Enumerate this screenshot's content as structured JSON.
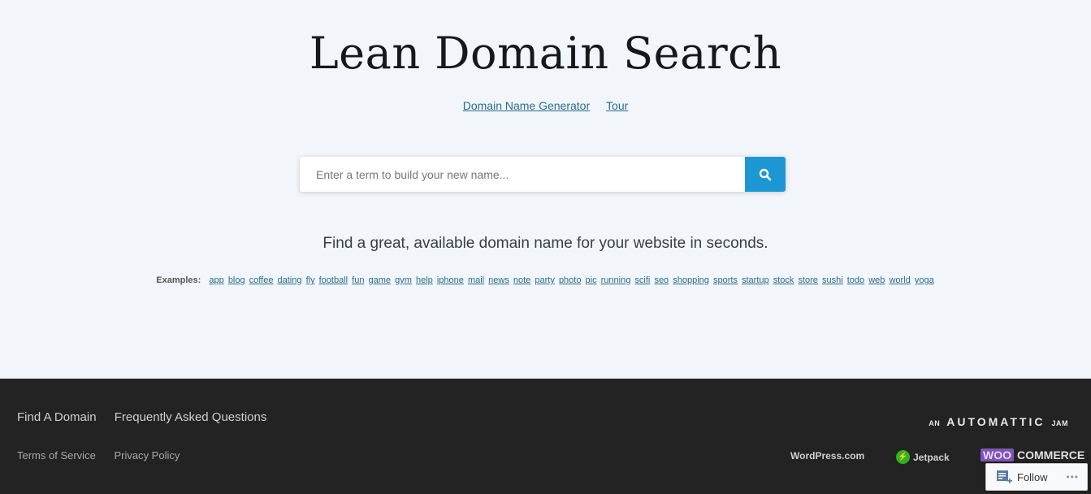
{
  "header": {
    "title": "Lean Domain Search",
    "nav": [
      {
        "label": "Domain Name Generator"
      },
      {
        "label": "Tour"
      }
    ]
  },
  "search": {
    "placeholder": "Enter a term to build your new name...",
    "value": "",
    "button_icon": "search-icon",
    "button_color": "#1c97d4"
  },
  "tagline": "Find a great, available domain name for your website in seconds.",
  "examples": {
    "label": "Examples:",
    "items": [
      "app",
      "blog",
      "coffee",
      "dating",
      "fly",
      "football",
      "fun",
      "game",
      "gym",
      "help",
      "iphone",
      "mail",
      "news",
      "note",
      "party",
      "photo",
      "pic",
      "running",
      "scifi",
      "seo",
      "shopping",
      "sports",
      "startup",
      "stock",
      "store",
      "sushi",
      "todo",
      "web",
      "world",
      "yoga"
    ]
  },
  "footer": {
    "primary_links": [
      "Find A Domain",
      "Frequently Asked Questions"
    ],
    "secondary_links": [
      "Terms of Service",
      "Privacy Policy"
    ],
    "automattic": {
      "prefix": "AN",
      "name": "AUTOMATTIC",
      "suffix": "JAM"
    },
    "brands": {
      "wordpress": "WordPress.com",
      "jetpack": "Jetpack",
      "woo": "WOO",
      "commerce": "COMMERCE"
    }
  },
  "follow_widget": {
    "label": "Follow",
    "more": "•••"
  }
}
